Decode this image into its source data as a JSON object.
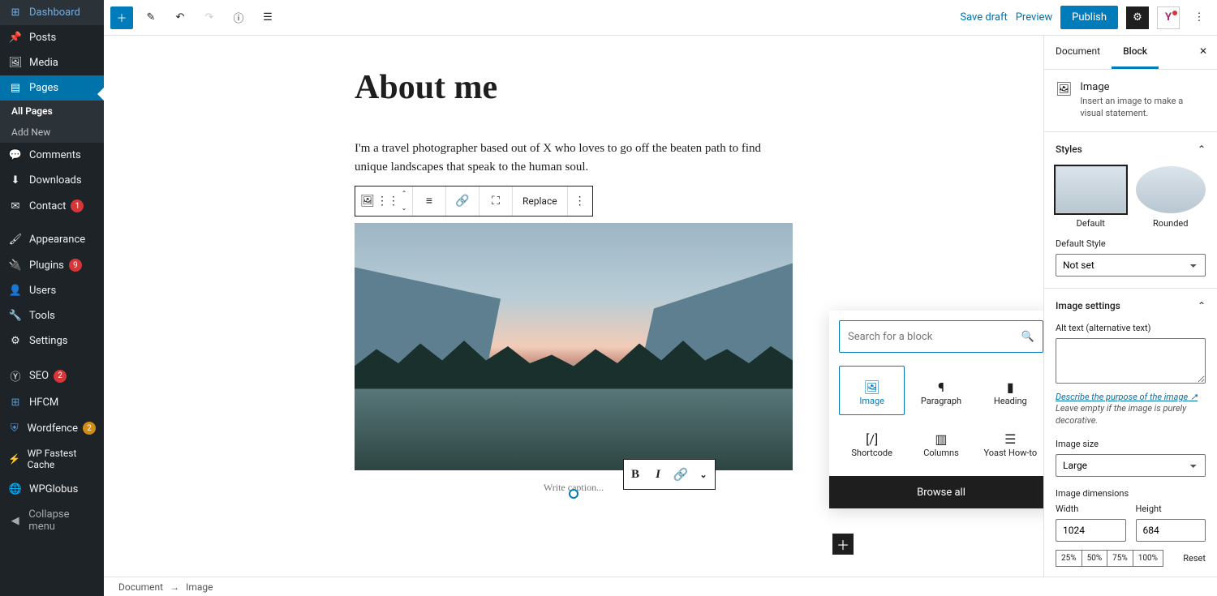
{
  "admin_menu": {
    "dashboard": "Dashboard",
    "posts": "Posts",
    "media": "Media",
    "pages": "Pages",
    "pages_sub_all": "All Pages",
    "pages_sub_new": "Add New",
    "comments": "Comments",
    "downloads": "Downloads",
    "contact": "Contact",
    "contact_badge": "1",
    "appearance": "Appearance",
    "plugins": "Plugins",
    "plugins_badge": "9",
    "users": "Users",
    "tools": "Tools",
    "settings": "Settings",
    "seo": "SEO",
    "seo_badge": "2",
    "hfcm": "HFCM",
    "wordfence": "Wordfence",
    "wordfence_badge": "2",
    "wpfc": "WP Fastest Cache",
    "wpglobus": "WPGlobus",
    "collapse": "Collapse menu"
  },
  "topbar": {
    "save_draft": "Save draft",
    "preview": "Preview",
    "publish": "Publish"
  },
  "page": {
    "title": "About me",
    "paragraph": "I'm a travel photographer based out of X who loves to go off the beaten path to find unique landscapes that speak to the human soul.",
    "caption_placeholder": "Write caption..."
  },
  "block_toolbar": {
    "replace": "Replace"
  },
  "inserter": {
    "search_placeholder": "Search for a block",
    "image": "Image",
    "paragraph": "Paragraph",
    "heading": "Heading",
    "shortcode": "Shortcode",
    "columns": "Columns",
    "yoast": "Yoast How-to",
    "browse_all": "Browse all"
  },
  "breadcrumb": {
    "document": "Document",
    "image": "Image"
  },
  "sidebar": {
    "tab_document": "Document",
    "tab_block": "Block",
    "block_info_title": "Image",
    "block_info_desc": "Insert an image to make a visual statement.",
    "styles_heading": "Styles",
    "style_default": "Default",
    "style_rounded": "Rounded",
    "default_style_label": "Default Style",
    "default_style_value": "Not set",
    "image_settings_heading": "Image settings",
    "alt_label": "Alt text (alternative text)",
    "alt_help_link": "Describe the purpose of the image",
    "alt_help_text": "Leave empty if the image is purely decorative.",
    "image_size_label": "Image size",
    "image_size_value": "Large",
    "dimensions_label": "Image dimensions",
    "width_label": "Width",
    "width_value": "1024",
    "height_label": "Height",
    "height_value": "684",
    "pct_25": "25%",
    "pct_50": "50%",
    "pct_75": "75%",
    "pct_100": "100%",
    "reset": "Reset"
  }
}
